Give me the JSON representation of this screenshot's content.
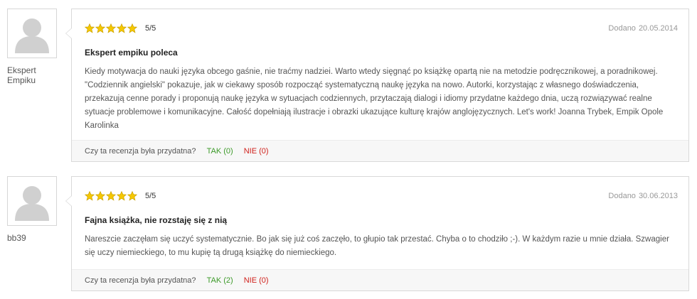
{
  "colors": {
    "star": "#f6c800",
    "yes": "#3c9a29",
    "no": "#d0211c"
  },
  "reviews": [
    {
      "author": "Ekspert Empiku",
      "rating": 5,
      "rating_text": "5/5",
      "date_prefix": "Dodano",
      "date": "20.05.2014",
      "title": "Ekspert empiku poleca",
      "body": "Kiedy motywacja do nauki języka obcego gaśnie, nie traćmy nadziei. Warto wtedy sięgnąć po książkę opartą nie na metodzie podręcznikowej, a poradnikowej. \"Codziennik angielski\" pokazuje, jak w ciekawy sposób rozpocząć systematyczną naukę języka na nowo. Autorki, korzystając z własnego doświadczenia, przekazują cenne porady i proponują naukę języka w sytuacjach codziennych, przytaczają dialogi i idiomy przydatne każdego dnia, uczą rozwiązywać realne sytuacje problemowe i komunikacyjne. Całość dopełniają ilustracje i obrazki ukazujące kulturę krajów anglojęzycznych. Let's work! Joanna Trybek, Empik Opole Karolinka",
      "helpful_question": "Czy ta recenzja była przydatna?",
      "yes_label": "TAK (0)",
      "no_label": "NIE (0)"
    },
    {
      "author": "bb39",
      "rating": 5,
      "rating_text": "5/5",
      "date_prefix": "Dodano",
      "date": "30.06.2013",
      "title": "Fajna książka, nie rozstaję się z nią",
      "body": "Nareszcie zaczęłam się uczyć systematycznie. Bo jak się już coś zaczęło, to głupio tak przestać. Chyba o to chodziło ;-). W każdym razie u mnie działa. Szwagier się uczy niemieckiego, to mu kupię tą drugą książkę do niemieckiego.",
      "helpful_question": "Czy ta recenzja była przydatna?",
      "yes_label": "TAK (2)",
      "no_label": "NIE (0)"
    }
  ]
}
